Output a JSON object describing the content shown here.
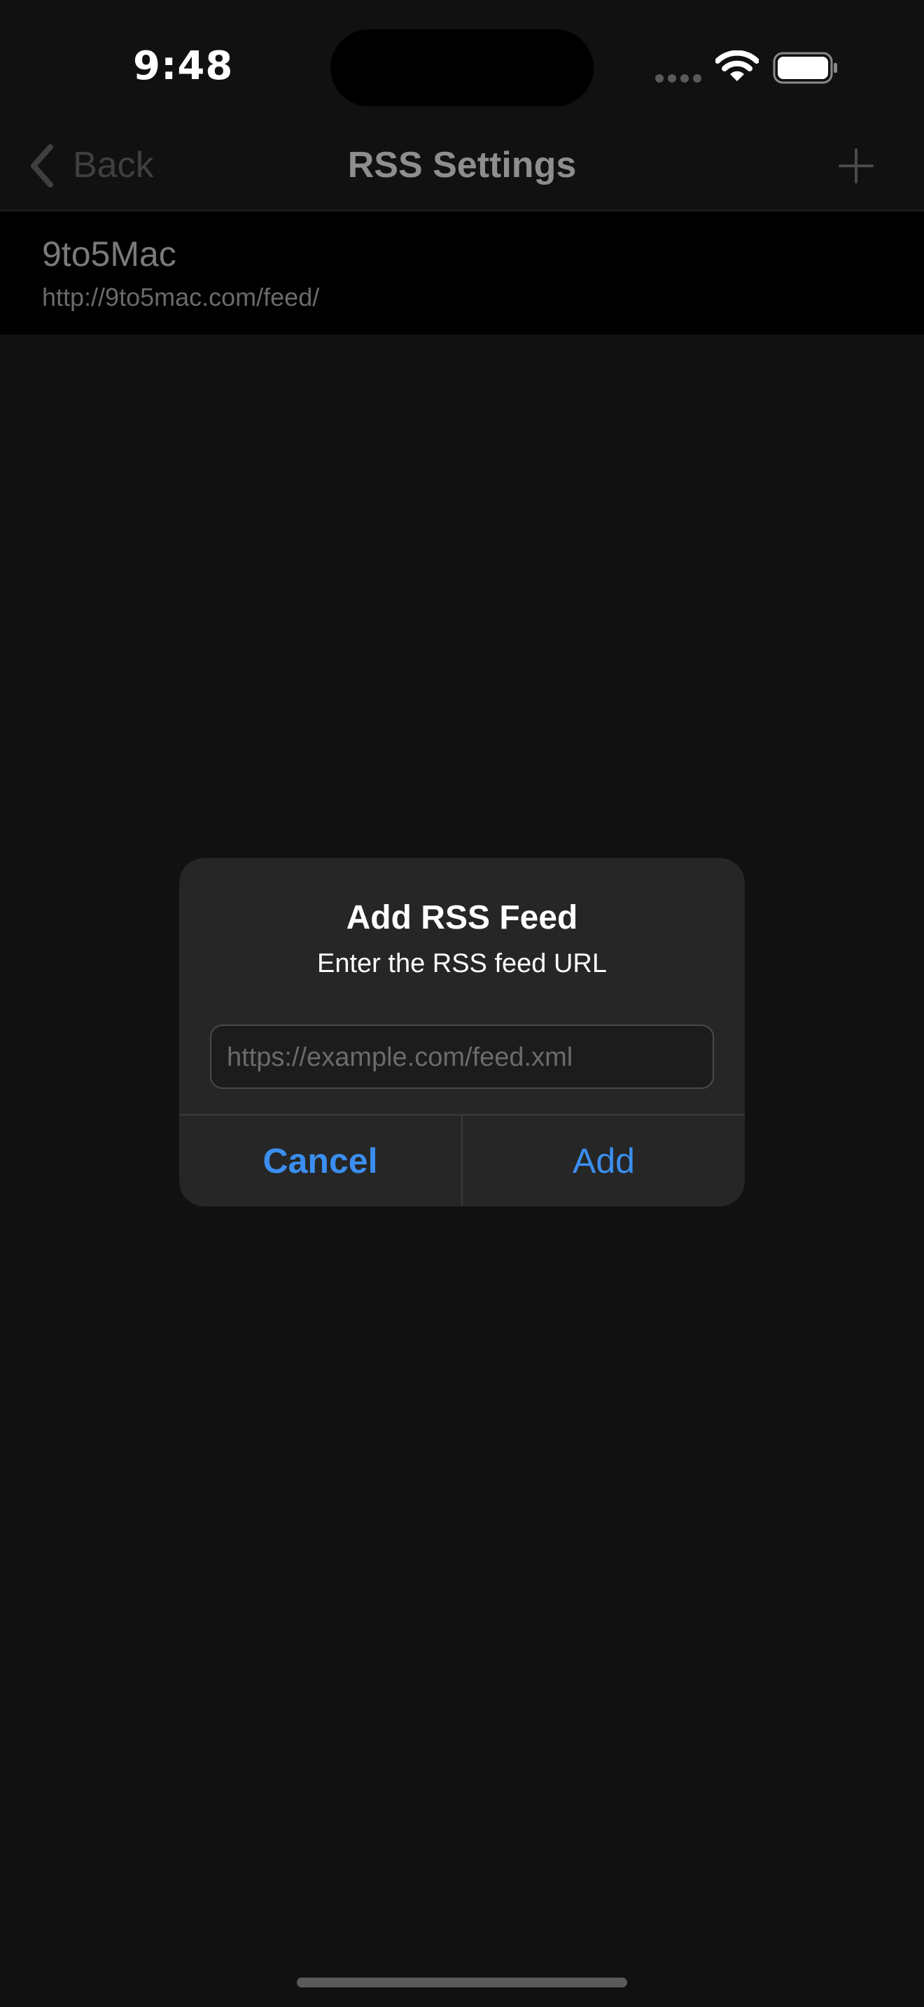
{
  "status_bar": {
    "time": "9:48",
    "signal_icon": "cellular-dots-icon",
    "wifi_icon": "wifi-icon",
    "battery_icon": "battery-icon"
  },
  "nav": {
    "back_label": "Back",
    "title": "RSS Settings",
    "add_icon": "plus-icon"
  },
  "feeds": [
    {
      "name": "9to5Mac",
      "url": "http://9to5mac.com/feed/"
    }
  ],
  "alert": {
    "title": "Add RSS Feed",
    "message": "Enter the RSS feed URL",
    "input_placeholder": "https://example.com/feed.xml",
    "input_value": "",
    "cancel_label": "Cancel",
    "add_label": "Add"
  },
  "colors": {
    "background": "#111111",
    "accent": "#3b8ef0",
    "alert_background": "#262626"
  }
}
